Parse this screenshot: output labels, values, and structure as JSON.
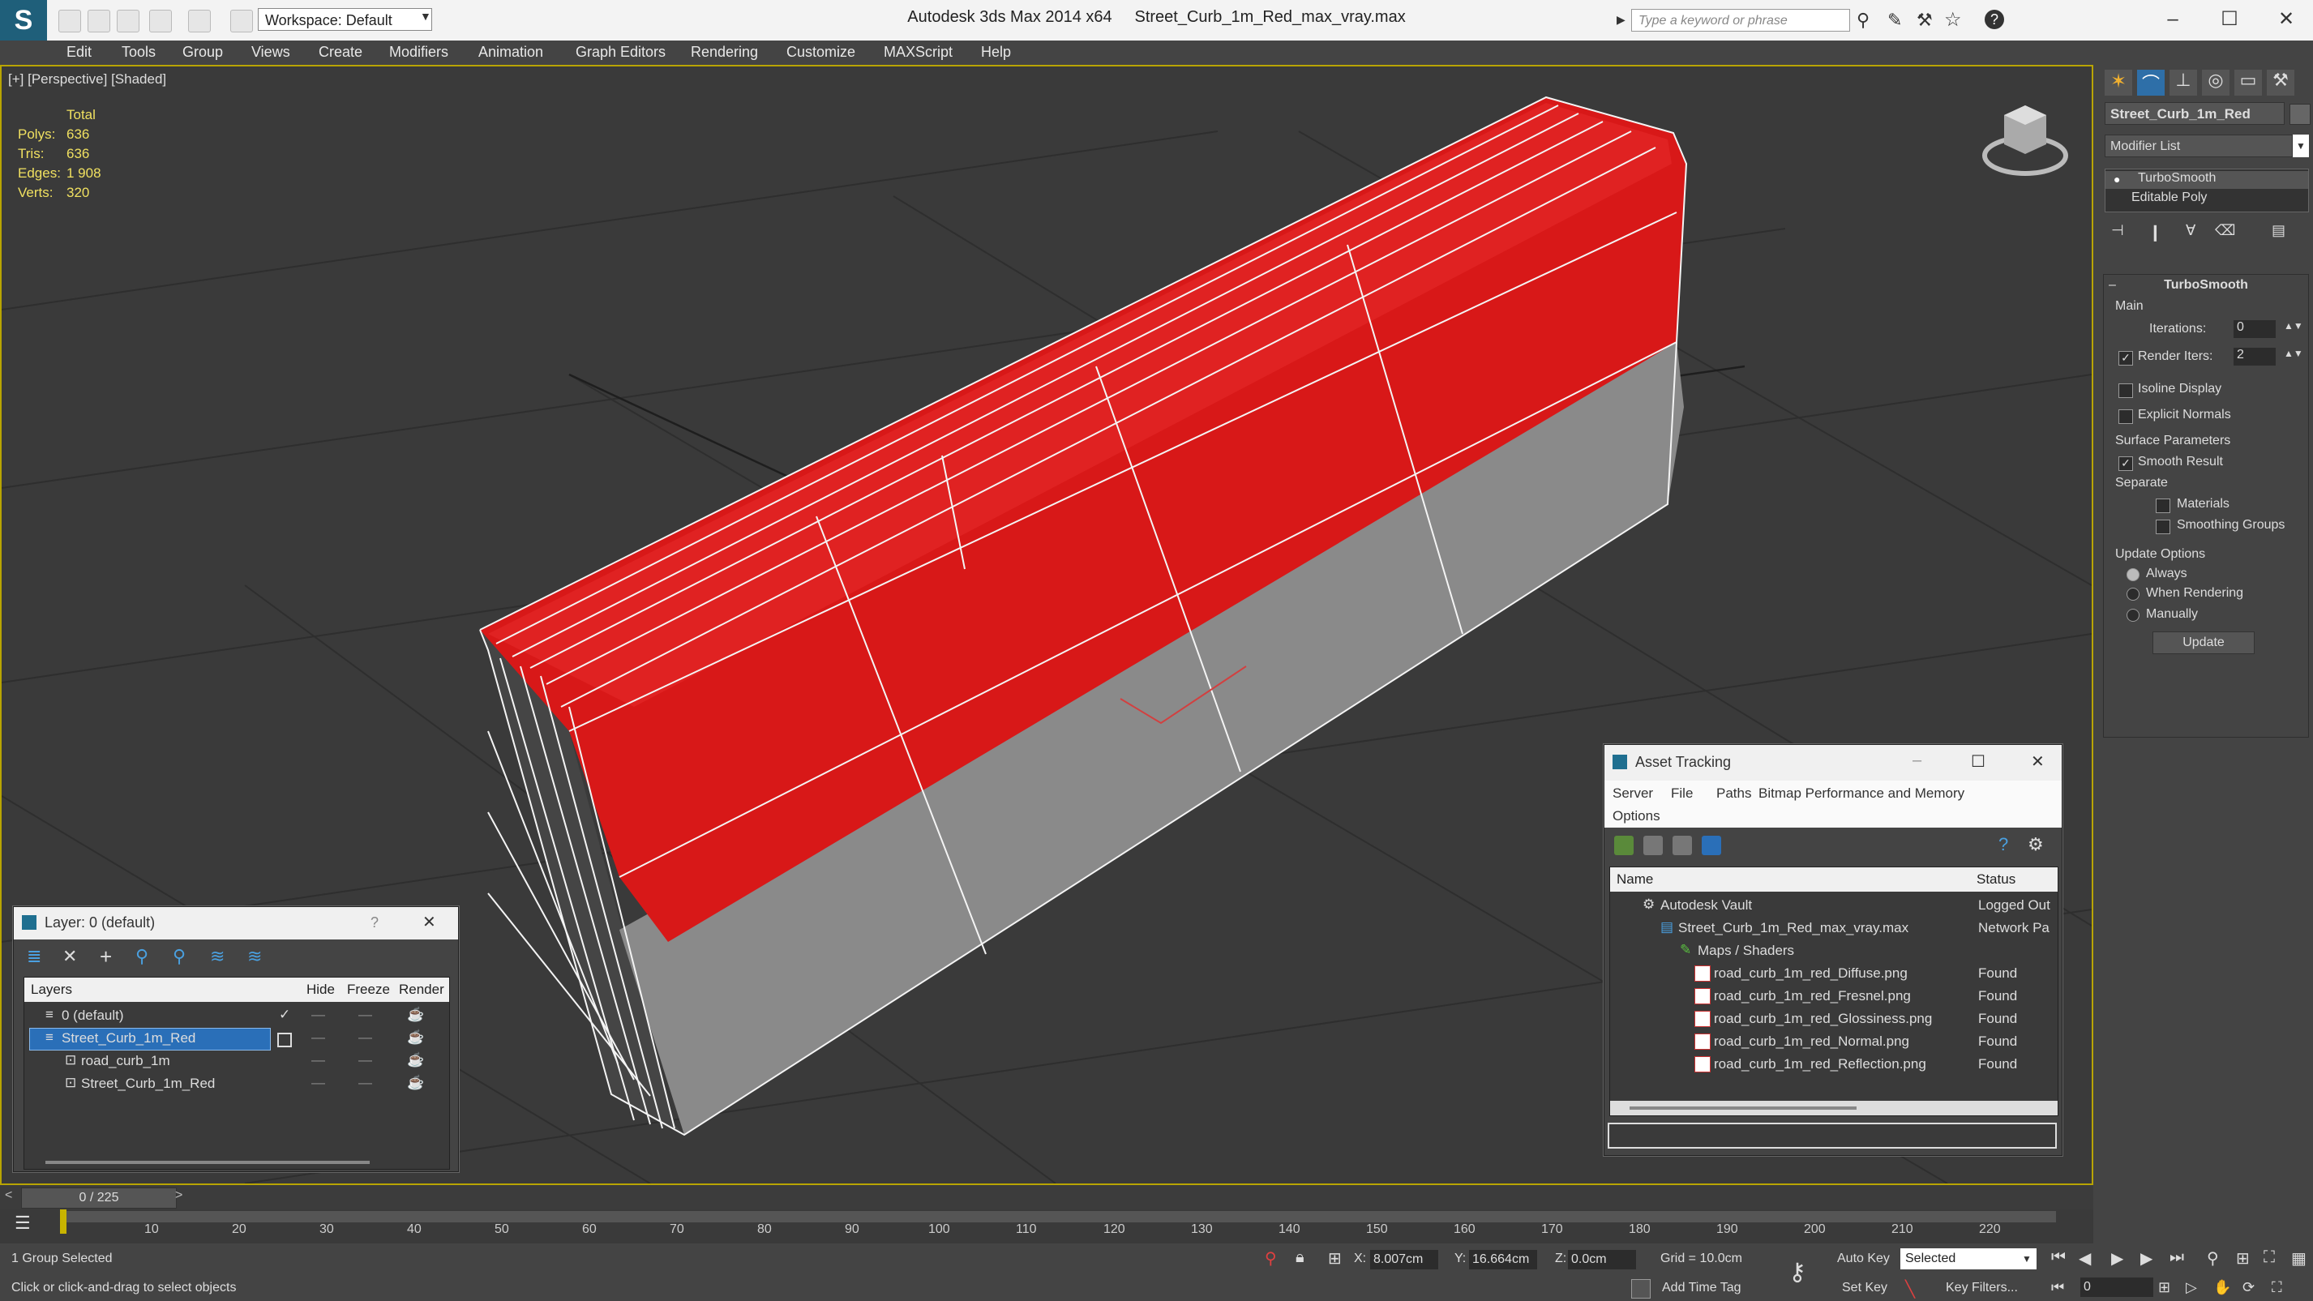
{
  "titlebar": {
    "app_title": "Autodesk 3ds Max  2014 x64",
    "file_title": "Street_Curb_1m_Red_max_vray.max",
    "workspace_label": "Workspace: Default",
    "search_placeholder": "Type a keyword or phrase"
  },
  "menu": [
    "Edit",
    "Tools",
    "Group",
    "Views",
    "Create",
    "Modifiers",
    "Animation",
    "Graph Editors",
    "Rendering",
    "Customize",
    "MAXScript",
    "Help"
  ],
  "viewport": {
    "label": "[+] [Perspective] [Shaded]",
    "stats_header": "Total",
    "stats": [
      {
        "label": "Polys:",
        "value": "636"
      },
      {
        "label": "Tris:",
        "value": "636"
      },
      {
        "label": "Edges:",
        "value": "1 908"
      },
      {
        "label": "Verts:",
        "value": "320"
      }
    ]
  },
  "command_panel": {
    "object_name": "Street_Curb_1m_Red",
    "modifier_list": "Modifier List",
    "stack": [
      "TurboSmooth",
      "Editable Poly"
    ],
    "rollout_title": "TurboSmooth",
    "main_label": "Main",
    "iterations_label": "Iterations:",
    "iterations_value": "0",
    "render_iters_label": "Render Iters:",
    "render_iters_value": "2",
    "isoline": "Isoline Display",
    "explicit_normals": "Explicit Normals",
    "surface_params": "Surface Parameters",
    "smooth_result": "Smooth Result",
    "separate": "Separate",
    "materials": "Materials",
    "smoothing_groups": "Smoothing Groups",
    "update_options": "Update Options",
    "always": "Always",
    "when_rendering": "When Rendering",
    "manually": "Manually",
    "update_button": "Update"
  },
  "layer_dialog": {
    "title": "Layer: 0 (default)",
    "help": "?",
    "columns": [
      "Layers",
      "Hide",
      "Freeze",
      "Render"
    ],
    "rows": [
      "0 (default)",
      "Street_Curb_1m_Red",
      "road_curb_1m",
      "Street_Curb_1m_Red"
    ]
  },
  "asset_dialog": {
    "title": "Asset Tracking",
    "menu": [
      "Server",
      "File",
      "Paths",
      "Bitmap Performance and Memory",
      "Options"
    ],
    "columns": [
      "Name",
      "Status"
    ],
    "rows": [
      {
        "name": "Autodesk Vault",
        "status": "Logged Out"
      },
      {
        "name": "Street_Curb_1m_Red_max_vray.max",
        "status": "Network Pa"
      },
      {
        "name": "Maps / Shaders",
        "status": ""
      },
      {
        "name": "road_curb_1m_red_Diffuse.png",
        "status": "Found"
      },
      {
        "name": "road_curb_1m_red_Fresnel.png",
        "status": "Found"
      },
      {
        "name": "road_curb_1m_red_Glossiness.png",
        "status": "Found"
      },
      {
        "name": "road_curb_1m_red_Normal.png",
        "status": "Found"
      },
      {
        "name": "road_curb_1m_red_Reflection.png",
        "status": "Found"
      }
    ]
  },
  "timeline": {
    "frame_counter": "0 / 225",
    "ticks": [
      "10",
      "20",
      "30",
      "40",
      "50",
      "60",
      "70",
      "80",
      "90",
      "100",
      "110",
      "120",
      "130",
      "140",
      "150",
      "160",
      "170",
      "180",
      "190",
      "200",
      "210",
      "220"
    ]
  },
  "status": {
    "selection": "1 Group Selected",
    "prompt": "Click or click-and-drag to select objects",
    "x_label": "X:",
    "x_value": "8.007cm",
    "y_label": "Y:",
    "y_value": "16.664cm",
    "z_label": "Z:",
    "z_value": "0.0cm",
    "grid": "Grid = 10.0cm",
    "add_time_tag": "Add Time Tag",
    "auto_key": "Auto Key",
    "set_key": "Set Key",
    "selected_dropdown": "Selected",
    "key_filters": "Key Filters...",
    "frame_value": "0"
  }
}
